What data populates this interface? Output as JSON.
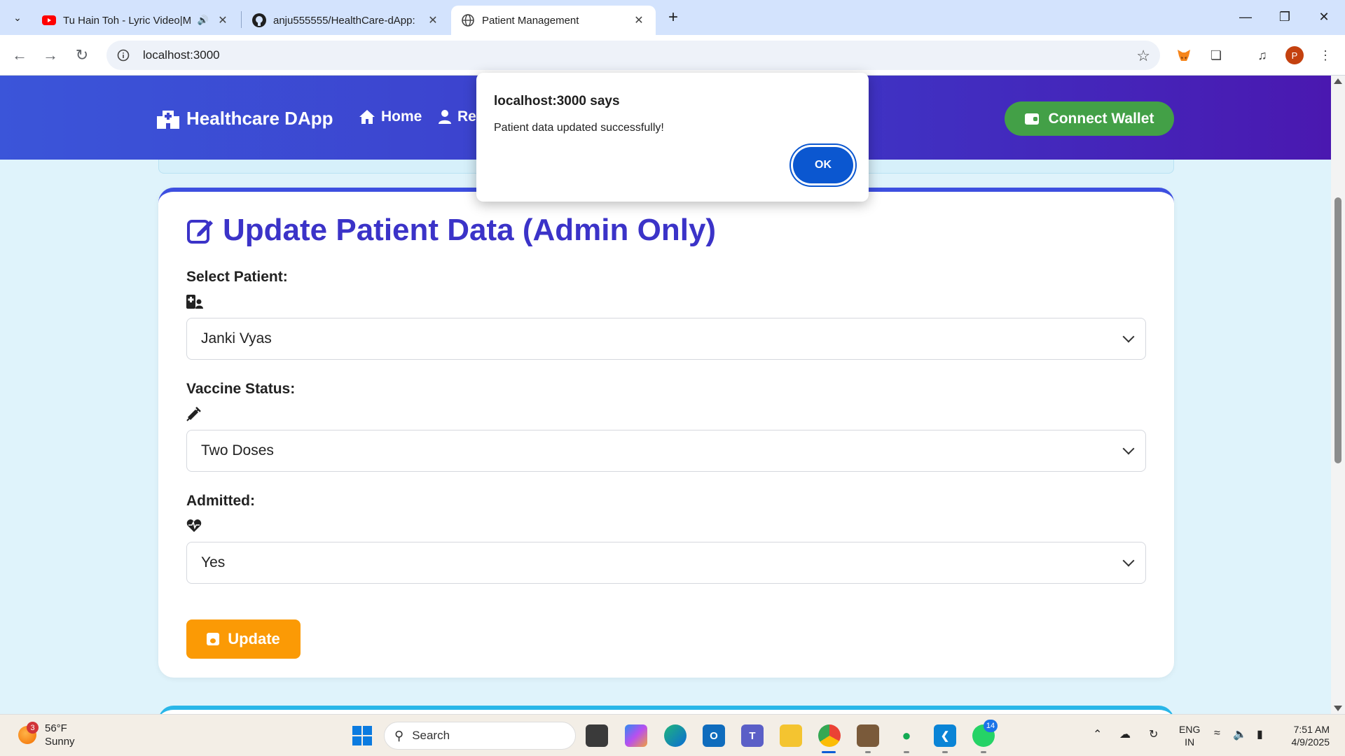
{
  "browser": {
    "tabs": [
      {
        "title": "Tu Hain Toh - Lyric Video|M",
        "icon": "youtube-icon"
      },
      {
        "title": "anju555555/HealthCare-dApp:",
        "icon": "github-icon"
      },
      {
        "title": "Patient Management",
        "icon": "globe-icon",
        "active": true
      }
    ],
    "url": "localhost:3000",
    "profile_initial": "P"
  },
  "app": {
    "brand": "Healthcare DApp",
    "nav": [
      {
        "label": "Home",
        "icon": "home-icon"
      },
      {
        "label": "Re",
        "icon": "user-icon"
      }
    ],
    "connect_wallet": "Connect Wallet"
  },
  "form": {
    "title": "Update Patient Data (Admin Only)",
    "fields": [
      {
        "label": "Select Patient:",
        "icon": "hospital-user-icon",
        "value": "Janki Vyas"
      },
      {
        "label": "Vaccine Status:",
        "icon": "syringe-icon",
        "value": "Two Doses"
      },
      {
        "label": "Admitted:",
        "icon": "heartbeat-icon",
        "value": "Yes"
      }
    ],
    "submit": "Update"
  },
  "dialog": {
    "title": "localhost:3000 says",
    "message": "Patient data updated successfully!",
    "ok": "OK"
  },
  "taskbar": {
    "weather": {
      "temp": "56°F",
      "condition": "Sunny",
      "badge": "3"
    },
    "search_placeholder": "Search",
    "whatsapp_badge": "14",
    "lang": [
      "ENG",
      "IN"
    ],
    "time": "7:51 AM",
    "date": "4/9/2025"
  },
  "colors": {
    "nav_gradient_start": "#3b55d9",
    "nav_gradient_end": "#4a18b0",
    "title": "#3b33c8",
    "connect_wallet": "#43a047",
    "update_button": "#fb9a05",
    "dialog_ok": "#0b57d0"
  }
}
